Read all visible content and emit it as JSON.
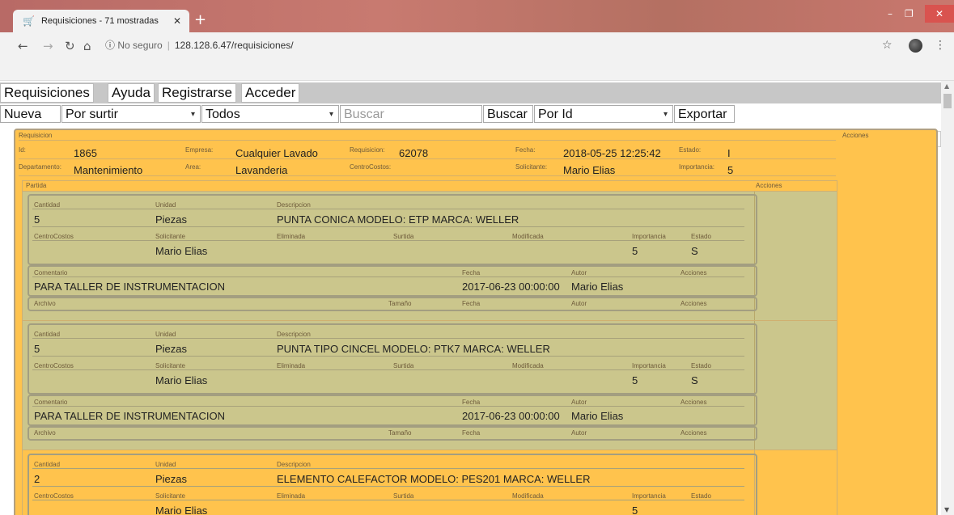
{
  "browser": {
    "tab_title": "Requisiciones - 71 mostradas",
    "url_prefix": "No seguro",
    "url": "128.128.6.47/requisiciones/"
  },
  "menu": [
    "Requisiciones",
    "Ayuda",
    "Registrarse",
    "Acceder"
  ],
  "filters": {
    "nueva": "Nueva",
    "estado": "Por surtir",
    "todos": "Todos",
    "buscar_placeholder": "Buscar",
    "buscar_button": "Buscar",
    "orden": "Por Id",
    "exportar": "Exportar"
  },
  "requisicion": {
    "header": "Requisicion",
    "acciones": "Acciones",
    "id_label": "Id:",
    "id": "1865",
    "empresa_label": "Empresa:",
    "empresa": "Cualquier Lavado",
    "requisicion_label": "Requisicion:",
    "requisicion": "62078",
    "fecha_label": "Fecha:",
    "fecha": "2018-05-25 12:25:42",
    "estado_label": "Estado:",
    "estado": "I",
    "departamento_label": "Departamento:",
    "departamento": "Mantenimiento",
    "area_label": "Area:",
    "area": "Lavanderia",
    "centrocostos_label": "CentroCostos:",
    "centrocostos": "",
    "solicitante_label": "Solicitante:",
    "solicitante": "Mario Elias",
    "importancia_label": "Importancia:",
    "importancia": "5"
  },
  "partida_header": {
    "partida": "Partida",
    "acciones": "Acciones"
  },
  "labels": {
    "cantidad": "Cantidad",
    "unidad": "Unidad",
    "descripcion": "Descripcion",
    "centrocostos": "CentroCostos",
    "solicitante": "Solicitante",
    "eliminada": "Eliminada",
    "surtida": "Surtida",
    "modificada": "Modificada",
    "importancia": "Importancia",
    "estado": "Estado",
    "comentario": "Comentario",
    "fecha": "Fecha",
    "autor": "Autor",
    "acciones": "Acciones",
    "archivo": "Archivo",
    "tamano": "Tamaño"
  },
  "partidas": [
    {
      "cantidad": "5",
      "unidad": "Piezas",
      "descripcion": "PUNTA CONICA MODELO: ETP MARCA: WELLER",
      "solicitante": "Mario Elias",
      "importancia": "5",
      "estado": "S",
      "comentario": "PARA TALLER DE INSTRUMENTACION",
      "fecha": "2017-06-23 00:00:00",
      "autor": "Mario Elias"
    },
    {
      "cantidad": "5",
      "unidad": "Piezas",
      "descripcion": "PUNTA TIPO CINCEL MODELO: PTK7 MARCA: WELLER",
      "solicitante": "Mario Elias",
      "importancia": "5",
      "estado": "S",
      "comentario": "PARA TALLER DE INSTRUMENTACION",
      "fecha": "2017-06-23 00:00:00",
      "autor": "Mario Elias"
    },
    {
      "cantidad": "2",
      "unidad": "Piezas",
      "descripcion": "ELEMENTO CALEFACTOR MODELO: PES201 MARCA: WELLER",
      "solicitante": "Mario Elias",
      "importancia": "5"
    }
  ],
  "colors": {
    "page": "#ffc34d",
    "olive": "#cbc68c",
    "border": "#a39e80",
    "menu": "#c7c7c7"
  }
}
